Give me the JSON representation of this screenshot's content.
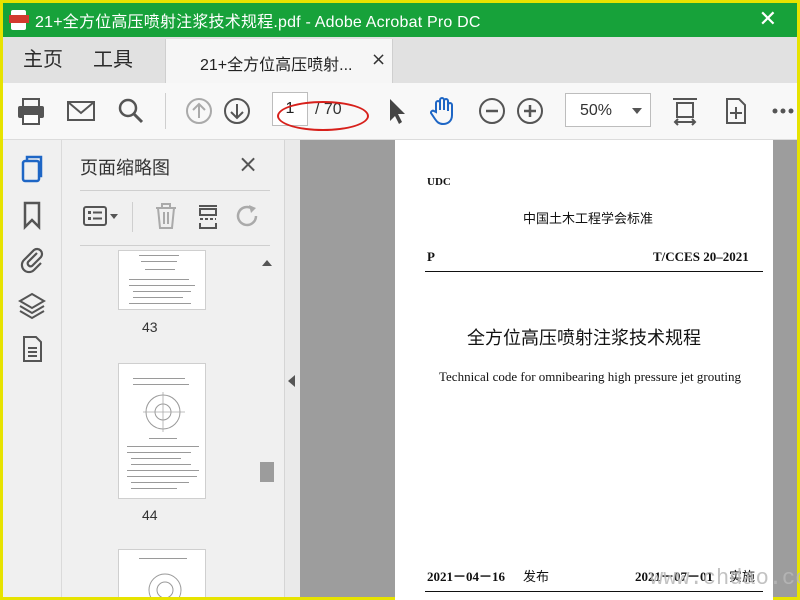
{
  "window": {
    "title": "21+全方位高压喷射注浆技术规程.pdf - Adobe Acrobat Pro DC",
    "close_glyph": "✕"
  },
  "nav": {
    "home": "主页",
    "tools": "工具",
    "doc_tab_label": "21+全方位高压喷射...",
    "doc_tab_close": "×"
  },
  "toolbar": {
    "page_current": "1",
    "page_total": "/ 70",
    "zoom": "50%",
    "icons": [
      "print-icon",
      "email-icon",
      "search-icon",
      "prev-page-icon",
      "next-page-icon",
      "select-cursor-icon",
      "hand-icon",
      "zoom-out-icon",
      "zoom-in-icon",
      "fit-page-icon",
      "rotate-view-icon",
      "more-icon"
    ],
    "accent": "#1e66c5",
    "annotation_color": "#d7201b"
  },
  "thumbnails_panel": {
    "title": "页面缩略图",
    "close": "×",
    "pages": [
      {
        "number": "43"
      },
      {
        "number": "44"
      }
    ]
  },
  "document": {
    "udc": "UDC",
    "org_standard": "中国土木工程学会标准",
    "letter_p": "P",
    "standard_code": "T/CCES 20–2021",
    "title_cn": "全方位高压喷射注浆技术规程",
    "title_en": "Technical code for omnibearing high pressure jet grouting",
    "issue_date": "2021－04－16",
    "issue_label": "发布",
    "effective_date": "2021－07－01",
    "effective_label": "实施"
  },
  "watermark": "www.chdao.co",
  "colors": {
    "titlebar": "#17a23a",
    "frame": "#e7e300"
  }
}
